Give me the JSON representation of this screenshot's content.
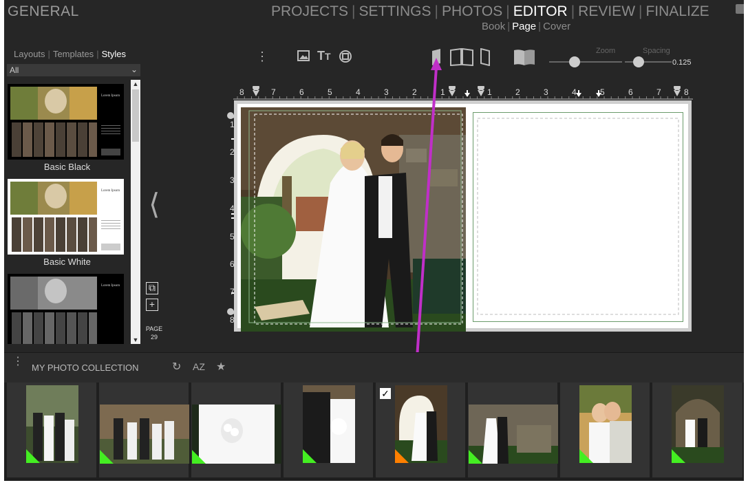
{
  "header": {
    "brand": "GENERAL",
    "nav": [
      {
        "label": "PROJECTS",
        "active": false
      },
      {
        "label": "SETTINGS",
        "active": false
      },
      {
        "label": "PHOTOS",
        "active": false
      },
      {
        "label": "EDITOR",
        "active": true
      },
      {
        "label": "REVIEW",
        "active": false
      },
      {
        "label": "FINALIZE",
        "active": false
      }
    ],
    "subnav": [
      {
        "label": "Book",
        "active": false
      },
      {
        "label": "Page",
        "active": true
      },
      {
        "label": "Cover",
        "active": false
      }
    ]
  },
  "left_panel": {
    "tabs": [
      {
        "label": "Layouts",
        "active": false
      },
      {
        "label": "Templates",
        "active": false
      },
      {
        "label": "Styles",
        "active": true
      }
    ],
    "filter_value": "All",
    "styles": [
      {
        "label": "Basic Black",
        "theme": "#000000"
      },
      {
        "label": "Basic White",
        "theme": "#ffffff"
      },
      {
        "label": "",
        "theme": "#000000"
      }
    ],
    "template_text": "Lorem Ipsum"
  },
  "toolbar": {
    "zoom_label": "Zoom",
    "spacing_label": "Spacing",
    "spacing_value": "0.125",
    "zoom_level": 0.35,
    "spacing_level": 0.3,
    "icons": [
      "more-icon",
      "image-icon",
      "text-icon",
      "shape-icon",
      "left-page-icon",
      "spread-icon",
      "right-page-icon",
      "book-view-icon"
    ]
  },
  "page_indicator": {
    "label": "PAGE",
    "number": "29"
  },
  "ruler": {
    "horizontal": [
      "8",
      "7",
      "6",
      "5",
      "4",
      "3",
      "2",
      "1",
      "1",
      "2",
      "3",
      "4",
      "5",
      "6",
      "7",
      "8"
    ],
    "vertical": [
      "1",
      "2",
      "3",
      "4",
      "5",
      "6",
      "7",
      "8"
    ]
  },
  "collection": {
    "title": "MY PHOTO COLLECTION",
    "sort_label": "AZ",
    "status_colors": {
      "used": "#44ee22",
      "selected": "#ff7f00",
      "annotation": "#c02fc8"
    },
    "photos": [
      {
        "id": 1,
        "status": "used",
        "orientation": "portrait"
      },
      {
        "id": 2,
        "status": "used",
        "orientation": "landscape"
      },
      {
        "id": 3,
        "status": "used",
        "orientation": "landscape"
      },
      {
        "id": 4,
        "status": "used",
        "orientation": "portrait"
      },
      {
        "id": 5,
        "status": "selected",
        "orientation": "portrait",
        "checked": true
      },
      {
        "id": 6,
        "status": "used",
        "orientation": "landscape"
      },
      {
        "id": 7,
        "status": "used",
        "orientation": "portrait"
      },
      {
        "id": 8,
        "status": "used",
        "orientation": "portrait"
      }
    ]
  }
}
